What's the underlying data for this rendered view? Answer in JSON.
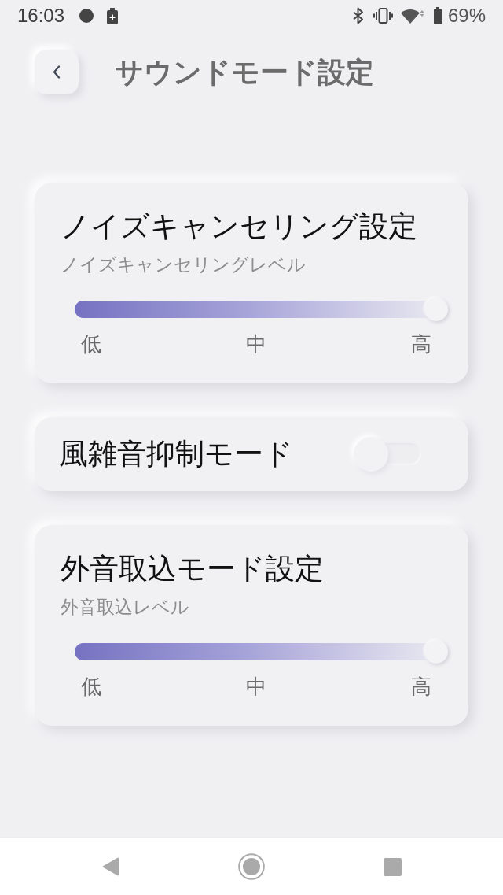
{
  "status_bar": {
    "time": "16:03",
    "battery_percent": "69%"
  },
  "header": {
    "title": "サウンドモード設定"
  },
  "settings": [
    {
      "kind": "slider",
      "title": "ノイズキャンセリング設定",
      "subtitle": "ノイズキャンセリングレベル",
      "level": 1,
      "ticks": [
        "低",
        "中",
        "高"
      ]
    },
    {
      "kind": "toggle",
      "title": "風雑音抑制モード",
      "on": false
    },
    {
      "kind": "slider",
      "title": "外音取込モード設定",
      "subtitle": "外音取込レベル",
      "level": 1,
      "ticks": [
        "低",
        "中",
        "高"
      ]
    }
  ]
}
